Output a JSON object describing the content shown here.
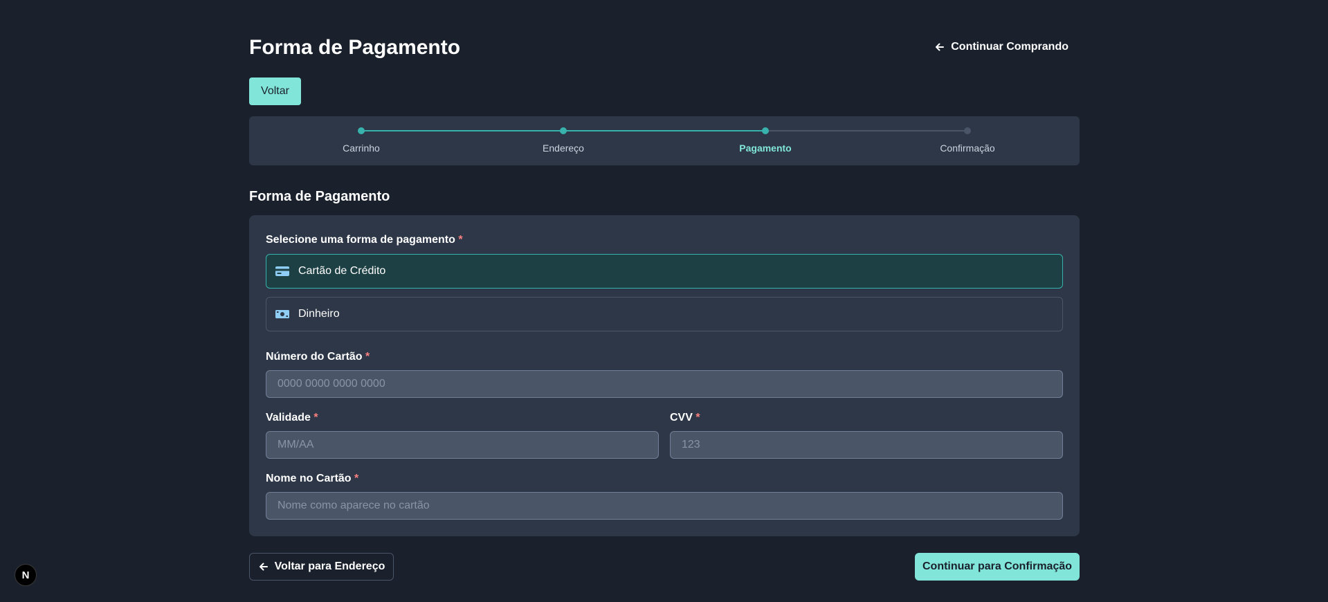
{
  "header": {
    "title": "Forma de Pagamento",
    "continue_shopping_label": "Continuar Comprando",
    "back_label": "Voltar"
  },
  "stepper": {
    "steps": [
      {
        "label": "Carrinho",
        "state": "completed"
      },
      {
        "label": "Endereço",
        "state": "completed"
      },
      {
        "label": "Pagamento",
        "state": "active"
      },
      {
        "label": "Confirmação",
        "state": "pending"
      }
    ]
  },
  "payment": {
    "section_title": "Forma de Pagamento",
    "select_label": "Selecione uma forma de pagamento",
    "required_mark": "*",
    "options": [
      {
        "label": "Cartão de Crédito",
        "icon": "credit-card-icon",
        "selected": true
      },
      {
        "label": "Dinheiro",
        "icon": "cash-icon",
        "selected": false
      }
    ],
    "card_number": {
      "label": "Número do Cartão",
      "placeholder": "0000 0000 0000 0000",
      "value": ""
    },
    "expiry": {
      "label": "Validade",
      "placeholder": "MM/AA",
      "value": ""
    },
    "cvv": {
      "label": "CVV",
      "placeholder": "123",
      "value": ""
    },
    "card_name": {
      "label": "Nome no Cartão",
      "placeholder": "Nome como aparece no cartão",
      "value": ""
    }
  },
  "footer": {
    "back_label": "Voltar para Endereço",
    "continue_label": "Continuar para Confirmação"
  },
  "dev_badge": {
    "label": "N"
  },
  "colors": {
    "background": "#1a202c",
    "card": "#2d3748",
    "accent": "#81e6d9",
    "progress": "#38b2ac",
    "required": "#fc8181"
  }
}
